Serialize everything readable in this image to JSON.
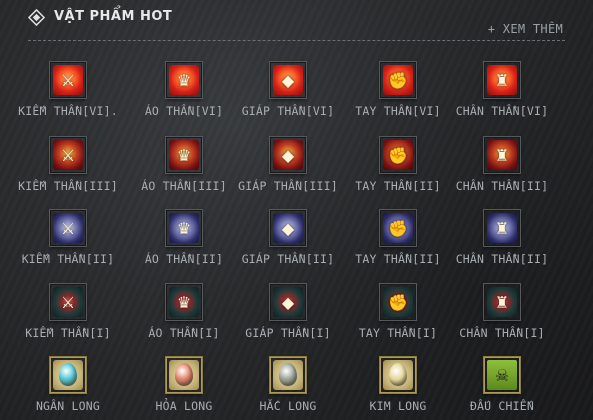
{
  "header": {
    "title": "VẬT PHẨM HOT",
    "see_more": "+ XEM THÊM",
    "icon": "diamond-icon"
  },
  "items": [
    {
      "label": "KIẾM THẦN[VI].",
      "tier": "vi",
      "icon": "sword-icon"
    },
    {
      "label": "ÁO THẦN[VI]",
      "tier": "vi",
      "icon": "armor-icon"
    },
    {
      "label": "GIÁP THẦN[VI]",
      "tier": "vi",
      "icon": "breastplate-icon"
    },
    {
      "label": "TAY THẦN[VI]",
      "tier": "vi",
      "icon": "gauntlet-icon"
    },
    {
      "label": "CHÂN THẦN[VI]",
      "tier": "vi",
      "icon": "boots-icon"
    },
    {
      "label": "KIẾM THẦN[III]",
      "tier": "iii",
      "icon": "sword-icon"
    },
    {
      "label": "ÁO THẦN[III]",
      "tier": "iii",
      "icon": "armor-icon"
    },
    {
      "label": "GIÁP THẦN[III]",
      "tier": "iii",
      "icon": "breastplate-icon"
    },
    {
      "label": "TAY THẦN[II]",
      "tier": "iii",
      "icon": "gauntlet-icon"
    },
    {
      "label": "CHÂN THẦN[II]",
      "tier": "iii",
      "icon": "boots-icon"
    },
    {
      "label": "KIẾM THẦN[II]",
      "tier": "ii",
      "icon": "sword-icon"
    },
    {
      "label": "ÁO THẦN[II]",
      "tier": "ii",
      "icon": "armor-icon"
    },
    {
      "label": "GIÁP THẦN[II]",
      "tier": "ii",
      "icon": "breastplate-icon"
    },
    {
      "label": "TAY THẦN[II]",
      "tier": "ii",
      "icon": "gauntlet-icon"
    },
    {
      "label": "CHÂN THẦN[II]",
      "tier": "ii",
      "icon": "boots-icon"
    },
    {
      "label": "KIẾM THẦN[I]",
      "tier": "i",
      "icon": "sword-icon"
    },
    {
      "label": "ÁO THẦN[I]",
      "tier": "i",
      "icon": "armor-icon"
    },
    {
      "label": "GIÁP THẦN[I]",
      "tier": "i",
      "icon": "breastplate-icon"
    },
    {
      "label": "TAY THẦN[I]",
      "tier": "i",
      "icon": "gauntlet-icon"
    },
    {
      "label": "CHÂN THẦN[I]",
      "tier": "i",
      "icon": "boots-icon"
    },
    {
      "label": "NGÂN LONG",
      "tier": "long",
      "icon": "silver-dragon-egg-icon",
      "egg_color": "#4fc6d6"
    },
    {
      "label": "HỎA LONG",
      "tier": "long",
      "icon": "fire-dragon-egg-icon",
      "egg_color": "#e1826a"
    },
    {
      "label": "HẮC LONG",
      "tier": "long",
      "icon": "black-dragon-egg-icon",
      "egg_color": "#9ba39b"
    },
    {
      "label": "KIM LONG",
      "tier": "long",
      "icon": "gold-dragon-egg-icon",
      "egg_color": "#e7d79a"
    },
    {
      "label": "ĐẤU CHIẾN",
      "tier": "long",
      "icon": "skull-crossbones-icon"
    }
  ]
}
